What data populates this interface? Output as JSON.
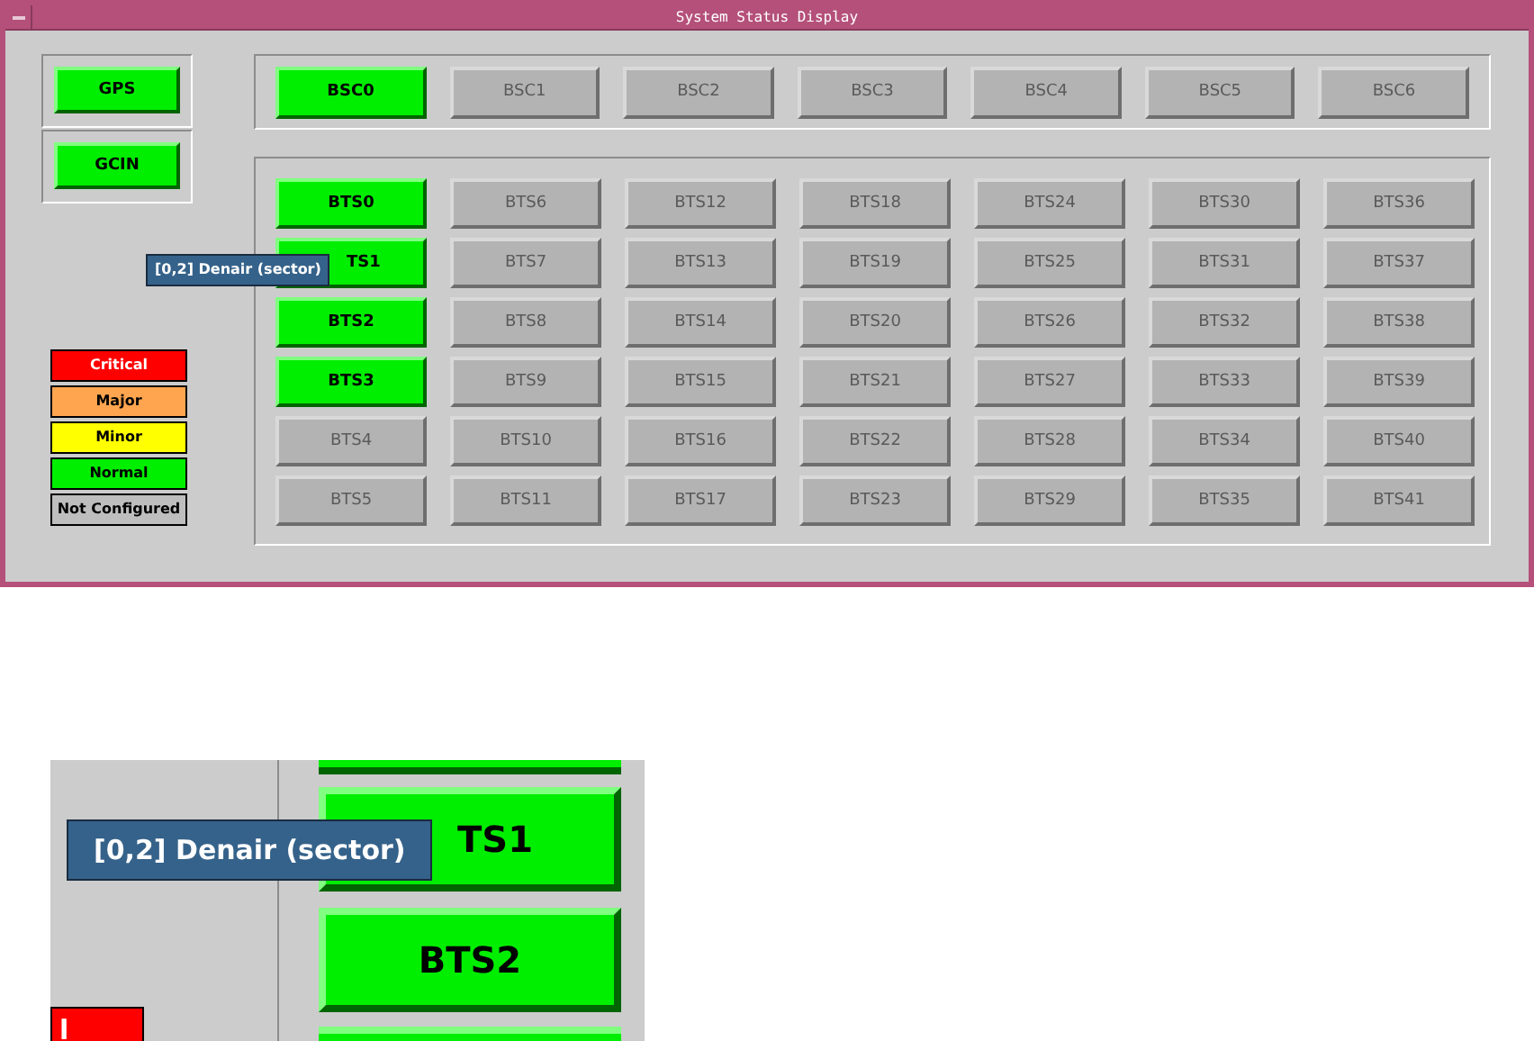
{
  "window": {
    "title": "System Status Display"
  },
  "units": [
    {
      "label": "GPS",
      "configured": true
    },
    {
      "label": "GCIN",
      "configured": true
    }
  ],
  "bsc": [
    {
      "label": "BSC0",
      "configured": true
    },
    {
      "label": "BSC1",
      "configured": false
    },
    {
      "label": "BSC2",
      "configured": false
    },
    {
      "label": "BSC3",
      "configured": false
    },
    {
      "label": "BSC4",
      "configured": false
    },
    {
      "label": "BSC5",
      "configured": false
    },
    {
      "label": "BSC6",
      "configured": false
    }
  ],
  "bts_columns": [
    [
      {
        "label": "BTS0",
        "configured": true
      },
      {
        "label": "TS1",
        "configured": true
      },
      {
        "label": "BTS2",
        "configured": true
      },
      {
        "label": "BTS3",
        "configured": true
      },
      {
        "label": "BTS4",
        "configured": false
      },
      {
        "label": "BTS5",
        "configured": false
      }
    ],
    [
      {
        "label": "BTS6",
        "configured": false
      },
      {
        "label": "BTS7",
        "configured": false
      },
      {
        "label": "BTS8",
        "configured": false
      },
      {
        "label": "BTS9",
        "configured": false
      },
      {
        "label": "BTS10",
        "configured": false
      },
      {
        "label": "BTS11",
        "configured": false
      }
    ],
    [
      {
        "label": "BTS12",
        "configured": false
      },
      {
        "label": "BTS13",
        "configured": false
      },
      {
        "label": "BTS14",
        "configured": false
      },
      {
        "label": "BTS15",
        "configured": false
      },
      {
        "label": "BTS16",
        "configured": false
      },
      {
        "label": "BTS17",
        "configured": false
      }
    ],
    [
      {
        "label": "BTS18",
        "configured": false
      },
      {
        "label": "BTS19",
        "configured": false
      },
      {
        "label": "BTS20",
        "configured": false
      },
      {
        "label": "BTS21",
        "configured": false
      },
      {
        "label": "BTS22",
        "configured": false
      },
      {
        "label": "BTS23",
        "configured": false
      }
    ],
    [
      {
        "label": "BTS24",
        "configured": false
      },
      {
        "label": "BTS25",
        "configured": false
      },
      {
        "label": "BTS26",
        "configured": false
      },
      {
        "label": "BTS27",
        "configured": false
      },
      {
        "label": "BTS28",
        "configured": false
      },
      {
        "label": "BTS29",
        "configured": false
      }
    ],
    [
      {
        "label": "BTS30",
        "configured": false
      },
      {
        "label": "BTS31",
        "configured": false
      },
      {
        "label": "BTS32",
        "configured": false
      },
      {
        "label": "BTS33",
        "configured": false
      },
      {
        "label": "BTS34",
        "configured": false
      },
      {
        "label": "BTS35",
        "configured": false
      }
    ],
    [
      {
        "label": "BTS36",
        "configured": false
      },
      {
        "label": "BTS37",
        "configured": false
      },
      {
        "label": "BTS38",
        "configured": false
      },
      {
        "label": "BTS39",
        "configured": false
      },
      {
        "label": "BTS40",
        "configured": false
      },
      {
        "label": "BTS41",
        "configured": false
      }
    ]
  ],
  "legend": [
    {
      "label": "Critical",
      "color": "#ff0000"
    },
    {
      "label": "Major",
      "color": "#ffa54f"
    },
    {
      "label": "Minor",
      "color": "#ffff00"
    },
    {
      "label": "Normal",
      "color": "#00ee00"
    },
    {
      "label": "Not Configured",
      "color": "#bebebe"
    }
  ],
  "tooltip": "[0,2] Denair (sector)",
  "inset": {
    "tooltip": "[0,2] Denair (sector)",
    "buttons": [
      {
        "label": "TS1",
        "configured": true
      },
      {
        "label": "BTS2",
        "configured": true
      }
    ],
    "legend_fragment": {
      "label": "l",
      "color": "#ff0000"
    }
  }
}
